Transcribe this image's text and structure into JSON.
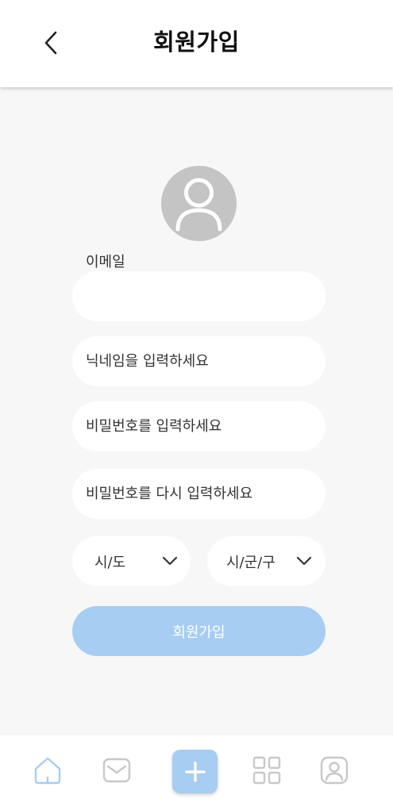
{
  "header": {
    "title": "회원가입"
  },
  "form": {
    "email_label": "이메일",
    "email_value": "",
    "nickname_placeholder": "닉네임을 입력하세요",
    "password_placeholder": "비밀번호를 입력하세요",
    "password_confirm_placeholder": "비밀번호를 다시 입력하세요",
    "region_select": "시/도",
    "district_select": "시/군/구",
    "submit_label": "회원가입"
  },
  "bottom_nav": {
    "items": [
      {
        "icon": "home-icon",
        "active": true
      },
      {
        "icon": "mail-icon",
        "active": false
      },
      {
        "icon": "plus-icon",
        "active": false
      },
      {
        "icon": "grid-icon",
        "active": false
      },
      {
        "icon": "profile-icon",
        "active": false
      }
    ]
  },
  "colors": {
    "accent": "#a7cdf2",
    "background": "#f7f7f7",
    "avatar": "#c4c4c4",
    "inactive_icon": "#c8c8c8"
  }
}
